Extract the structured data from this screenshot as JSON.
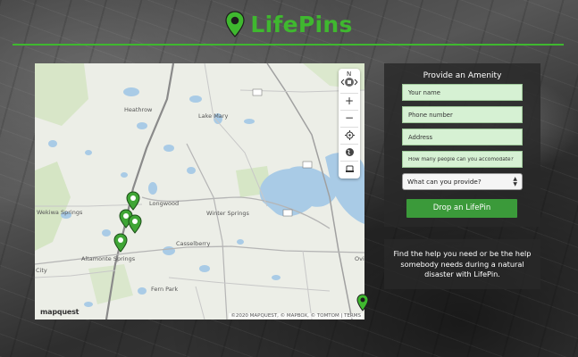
{
  "header": {
    "title": "LifePins",
    "logo_icon": "map-pin-icon"
  },
  "colors": {
    "brand_green": "#3fb82f",
    "button_green": "#3b9a3a",
    "field_bg": "#d6f1d3",
    "panel_bg": "#282828"
  },
  "map": {
    "towns": [
      "Heathrow",
      "Lake Mary",
      "Longwood",
      "Wekiwa Springs",
      "Winter Springs",
      "Altamonte Springs",
      "Casselberry",
      "Fern Park",
      "City",
      "Ovi"
    ],
    "attribution": "©2020 MAPQUEST, © MAPBOX, © TOMTOM | TERMS",
    "provider_logo": "mapquest",
    "controls": {
      "compass_label": "N",
      "zoom_in": "+",
      "zoom_out": "−"
    },
    "pin_count": 4
  },
  "form": {
    "title": "Provide an Amenity",
    "name_placeholder": "Your name",
    "phone_placeholder": "Phone number",
    "address_placeholder": "Address",
    "capacity_placeholder": "How many people can you accomodate?",
    "provide_select": "What can you provide?",
    "submit_label": "Drop an LifePin"
  },
  "info": {
    "text": "Find the help you need or be the help somebody needs during a natural disaster with LifePin."
  }
}
